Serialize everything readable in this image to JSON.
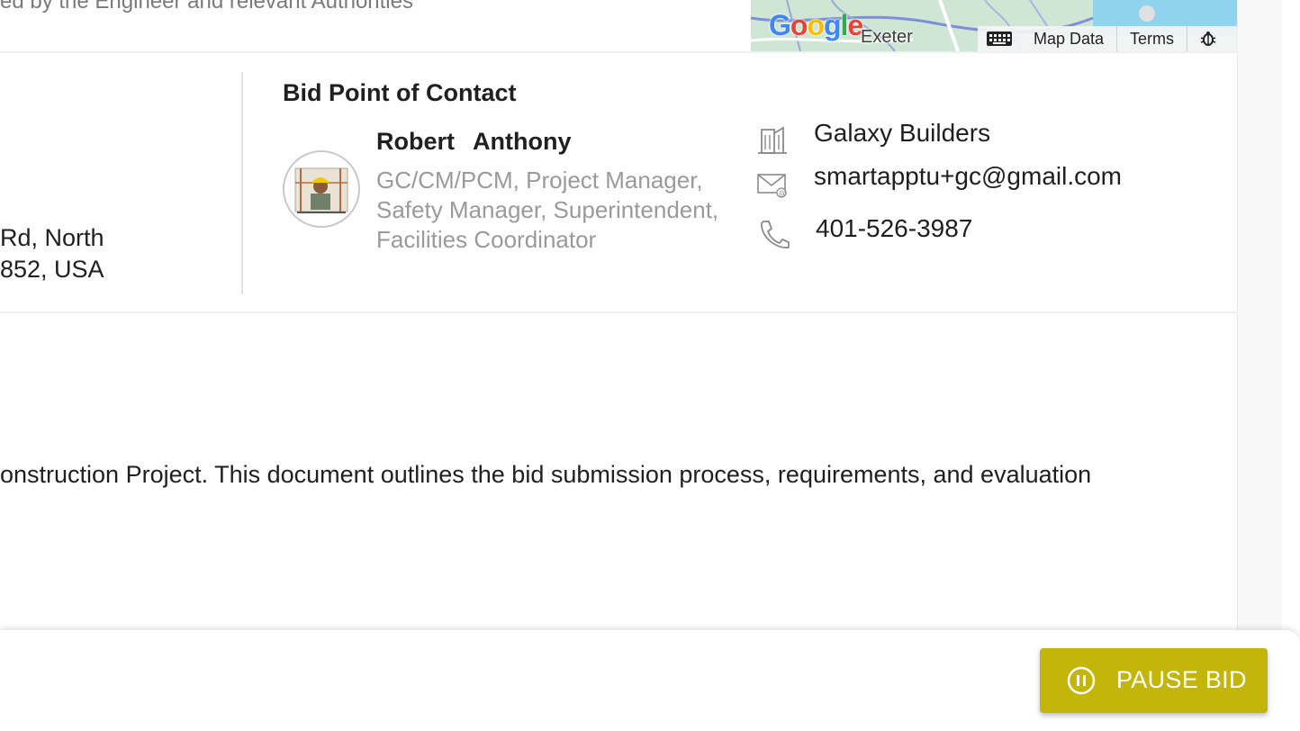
{
  "header": {
    "scope_snippet": "ed by the Engineer and relevant Authorities"
  },
  "map": {
    "logo_text": "Google",
    "city_label": "Exeter",
    "keyboard_icon": "keyboard-icon",
    "map_data_label": "Map Data",
    "terms_label": "Terms",
    "report_icon": "bug-icon"
  },
  "location": {
    "address_line_1": "Rd, North",
    "address_line_2": "852, USA"
  },
  "contact": {
    "heading": "Bid Point of Contact",
    "first_name": "Robert",
    "last_name": "Anthony",
    "roles": [
      "GC/CM/PCM, Project Manager,",
      "Safety Manager, Superintendent,",
      "Facilities Coordinator"
    ],
    "company": "Galaxy Builders",
    "email": "smartapptu+gc@gmail.com",
    "phone": "401-526-3987",
    "company_icon": "building-icon",
    "email_icon": "email-icon",
    "phone_icon": "phone-icon",
    "avatar_icon": "avatar"
  },
  "description": {
    "text": "onstruction Project. This document outlines the bid submission process, requirements, and evaluation"
  },
  "actions": {
    "pause_bid_label": "PAUSE BID",
    "pause_icon": "pause-circle-icon",
    "button_color": "#c4b50a"
  }
}
